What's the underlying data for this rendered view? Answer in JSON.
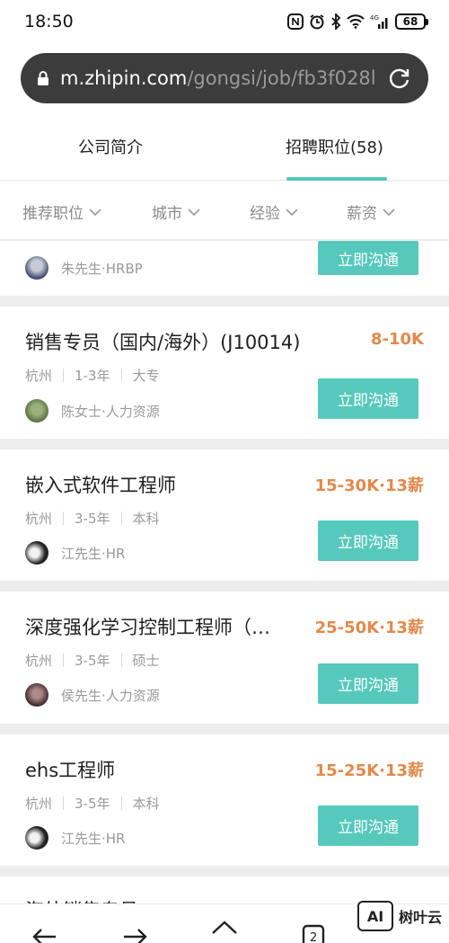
{
  "status": {
    "time": "18:50",
    "battery": "68",
    "network": "4G"
  },
  "browser": {
    "url_host": "m.zhipin.com",
    "url_path": "/gongsi/job/fb3f028l"
  },
  "tabs": [
    {
      "label": "公司简介"
    },
    {
      "label": "招聘职位(58)"
    }
  ],
  "filters": [
    {
      "label": "推荐职位"
    },
    {
      "label": "城市"
    },
    {
      "label": "经验"
    },
    {
      "label": "薪资"
    }
  ],
  "top_partial": {
    "recruiter": "朱先生·HRBP",
    "button": "立即沟通"
  },
  "jobs": [
    {
      "title": "销售专员（国内/海外）(J10014)",
      "salary": "8-10K",
      "city": "杭州",
      "experience": "1-3年",
      "education": "大专",
      "recruiter": "陈女士·人力资源",
      "button": "立即沟通"
    },
    {
      "title": "嵌入式软件工程师",
      "salary": "15-30K·13薪",
      "city": "杭州",
      "experience": "3-5年",
      "education": "本科",
      "recruiter": "江先生·HR",
      "button": "立即沟通"
    },
    {
      "title": "深度强化学习控制工程师（…",
      "salary": "25-50K·13薪",
      "city": "杭州",
      "experience": "3-5年",
      "education": "硕士",
      "recruiter": "侯先生·人力资源",
      "button": "立即沟通"
    },
    {
      "title": "ehs工程师",
      "salary": "15-25K·13薪",
      "city": "杭州",
      "experience": "3-5年",
      "education": "本科",
      "recruiter": "江先生·HR",
      "button": "立即沟通"
    }
  ],
  "peek_title": "海外销售专员",
  "watermark": {
    "logo": "AI",
    "text": "树叶云"
  },
  "colors": {
    "accent": "#56c9bc",
    "salary": "#e4894a"
  }
}
